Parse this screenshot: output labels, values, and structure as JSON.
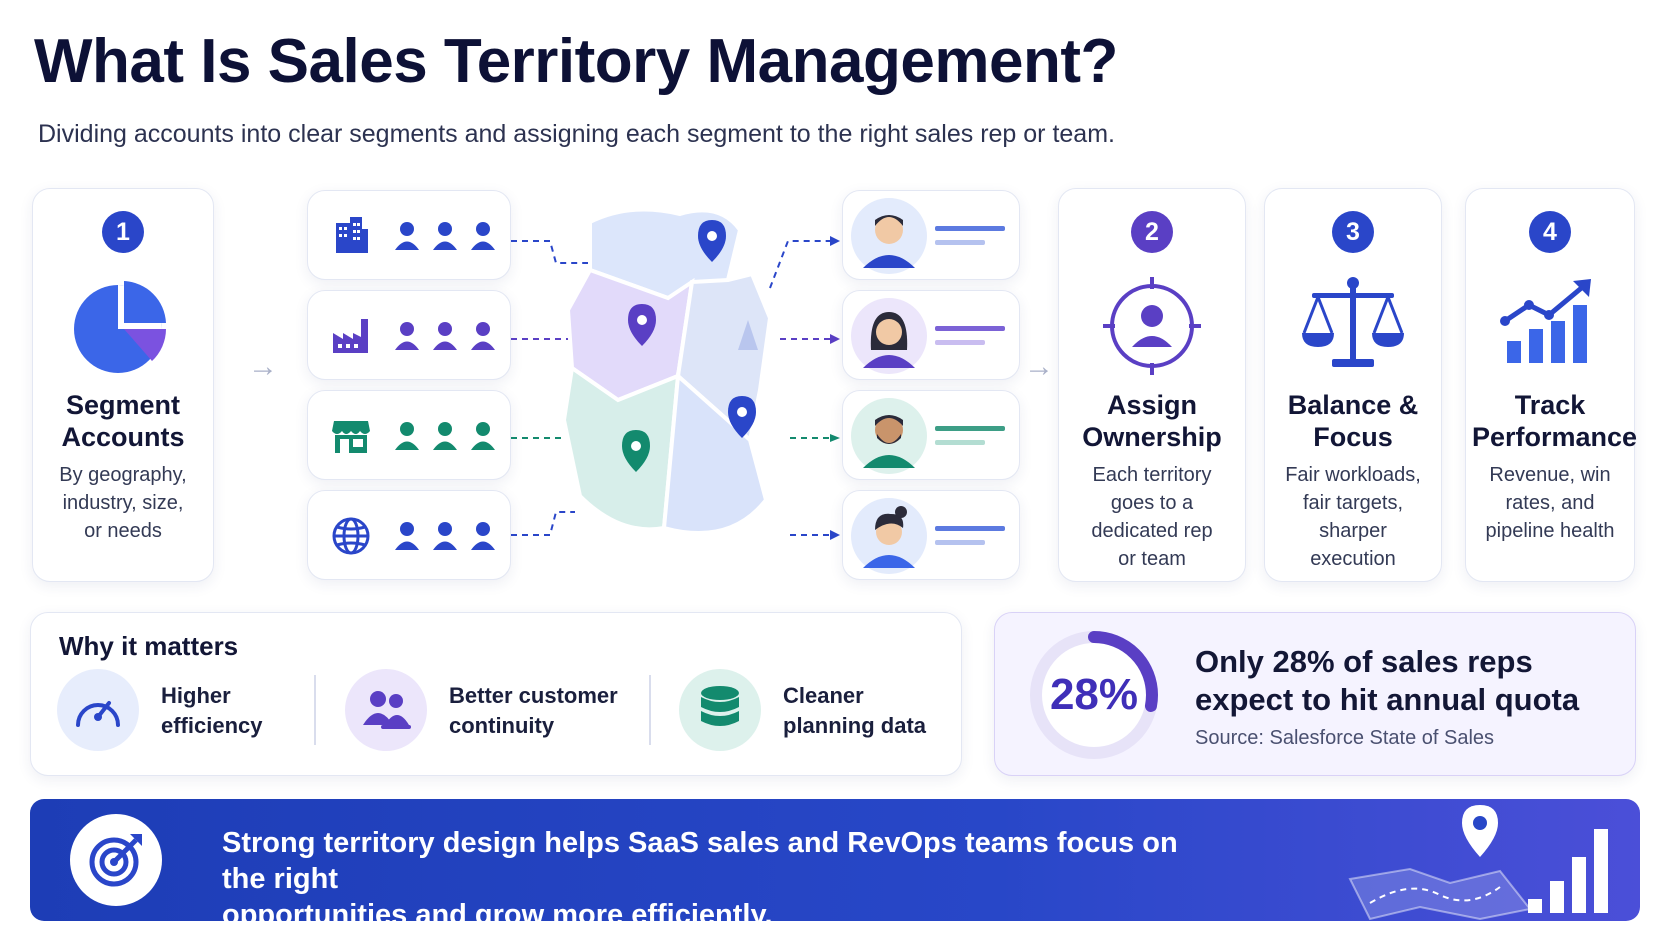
{
  "header": {
    "title": "What Is Sales Territory Management?",
    "subtitle": "Dividing accounts into clear segments and assigning each segment to the right sales rep or team."
  },
  "steps": [
    {
      "num": "1",
      "title_line1": "Segment",
      "title_line2": "Accounts",
      "desc_line1": "By geography,",
      "desc_line2": "industry, size,",
      "desc_line3": "or needs",
      "desc_line4": ""
    },
    {
      "num": "2",
      "title_line1": "Assign",
      "title_line2": "Ownership",
      "desc_line1": "Each territory",
      "desc_line2": "goes to a",
      "desc_line3": "dedicated rep",
      "desc_line4": "or team"
    },
    {
      "num": "3",
      "title_line1": "Balance &",
      "title_line2": "Focus",
      "desc_line1": "Fair workloads,",
      "desc_line2": "fair targets,",
      "desc_line3": "sharper execution",
      "desc_line4": ""
    },
    {
      "num": "4",
      "title_line1": "Track",
      "title_line2": "Performance",
      "desc_line1": "Revenue, win",
      "desc_line2": "rates, and",
      "desc_line3": "pipeline health",
      "desc_line4": ""
    }
  ],
  "segments": [
    {
      "icon": "building-icon",
      "color": "#2a46c9"
    },
    {
      "icon": "factory-icon",
      "color": "#5a3fc4"
    },
    {
      "icon": "store-icon",
      "color": "#138a6e"
    },
    {
      "icon": "globe-icon",
      "color": "#2a46c9"
    }
  ],
  "why": {
    "title": "Why it matters",
    "items": [
      {
        "icon": "speedometer-icon",
        "line1": "Higher",
        "line2": "efficiency"
      },
      {
        "icon": "team-icon",
        "line1": "Better customer",
        "line2": "continuity"
      },
      {
        "icon": "database-icon",
        "line1": "Cleaner",
        "line2": "planning data"
      }
    ]
  },
  "stat": {
    "percent": "28%",
    "value": 0.28,
    "headline_line1": "Only 28% of sales reps",
    "headline_line2": "expect to hit annual quota",
    "source": "Source: Salesforce State of Sales"
  },
  "banner": {
    "line1": "Strong territory design helps SaaS sales and RevOps teams focus on the right",
    "line2": "opportunities and grow more efficiently."
  },
  "colors": {
    "blue": "#2a46c9",
    "purple": "#5a3fc4",
    "teal": "#138a6e",
    "banner": "#2244c0"
  }
}
